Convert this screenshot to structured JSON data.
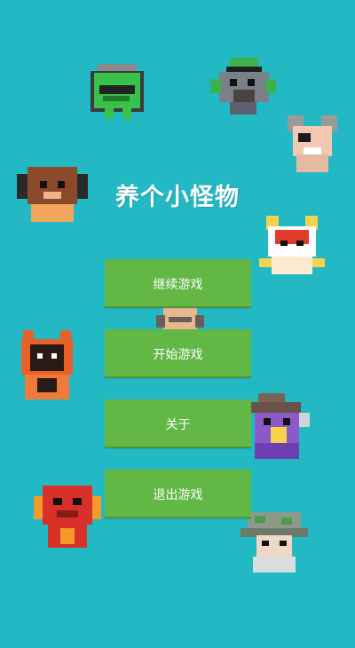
{
  "title": "养个小怪物",
  "menu": {
    "continue_label": "继续游戏",
    "start_label": "开始游戏",
    "about_label": "关于",
    "exit_label": "退出游戏"
  },
  "colors": {
    "background": "#22b8c4",
    "button": "#62b745",
    "button_text": "#ffffff",
    "title_text": "#ffffff"
  },
  "monsters": [
    "green-goblin-icon",
    "green-hat-dwarf-icon",
    "gray-mouse-icon",
    "brown-dog-icon",
    "red-fox-icon",
    "bald-monster-icon",
    "orange-cat-icon",
    "purple-wizard-icon",
    "red-dragon-icon",
    "gray-mushroom-icon"
  ]
}
